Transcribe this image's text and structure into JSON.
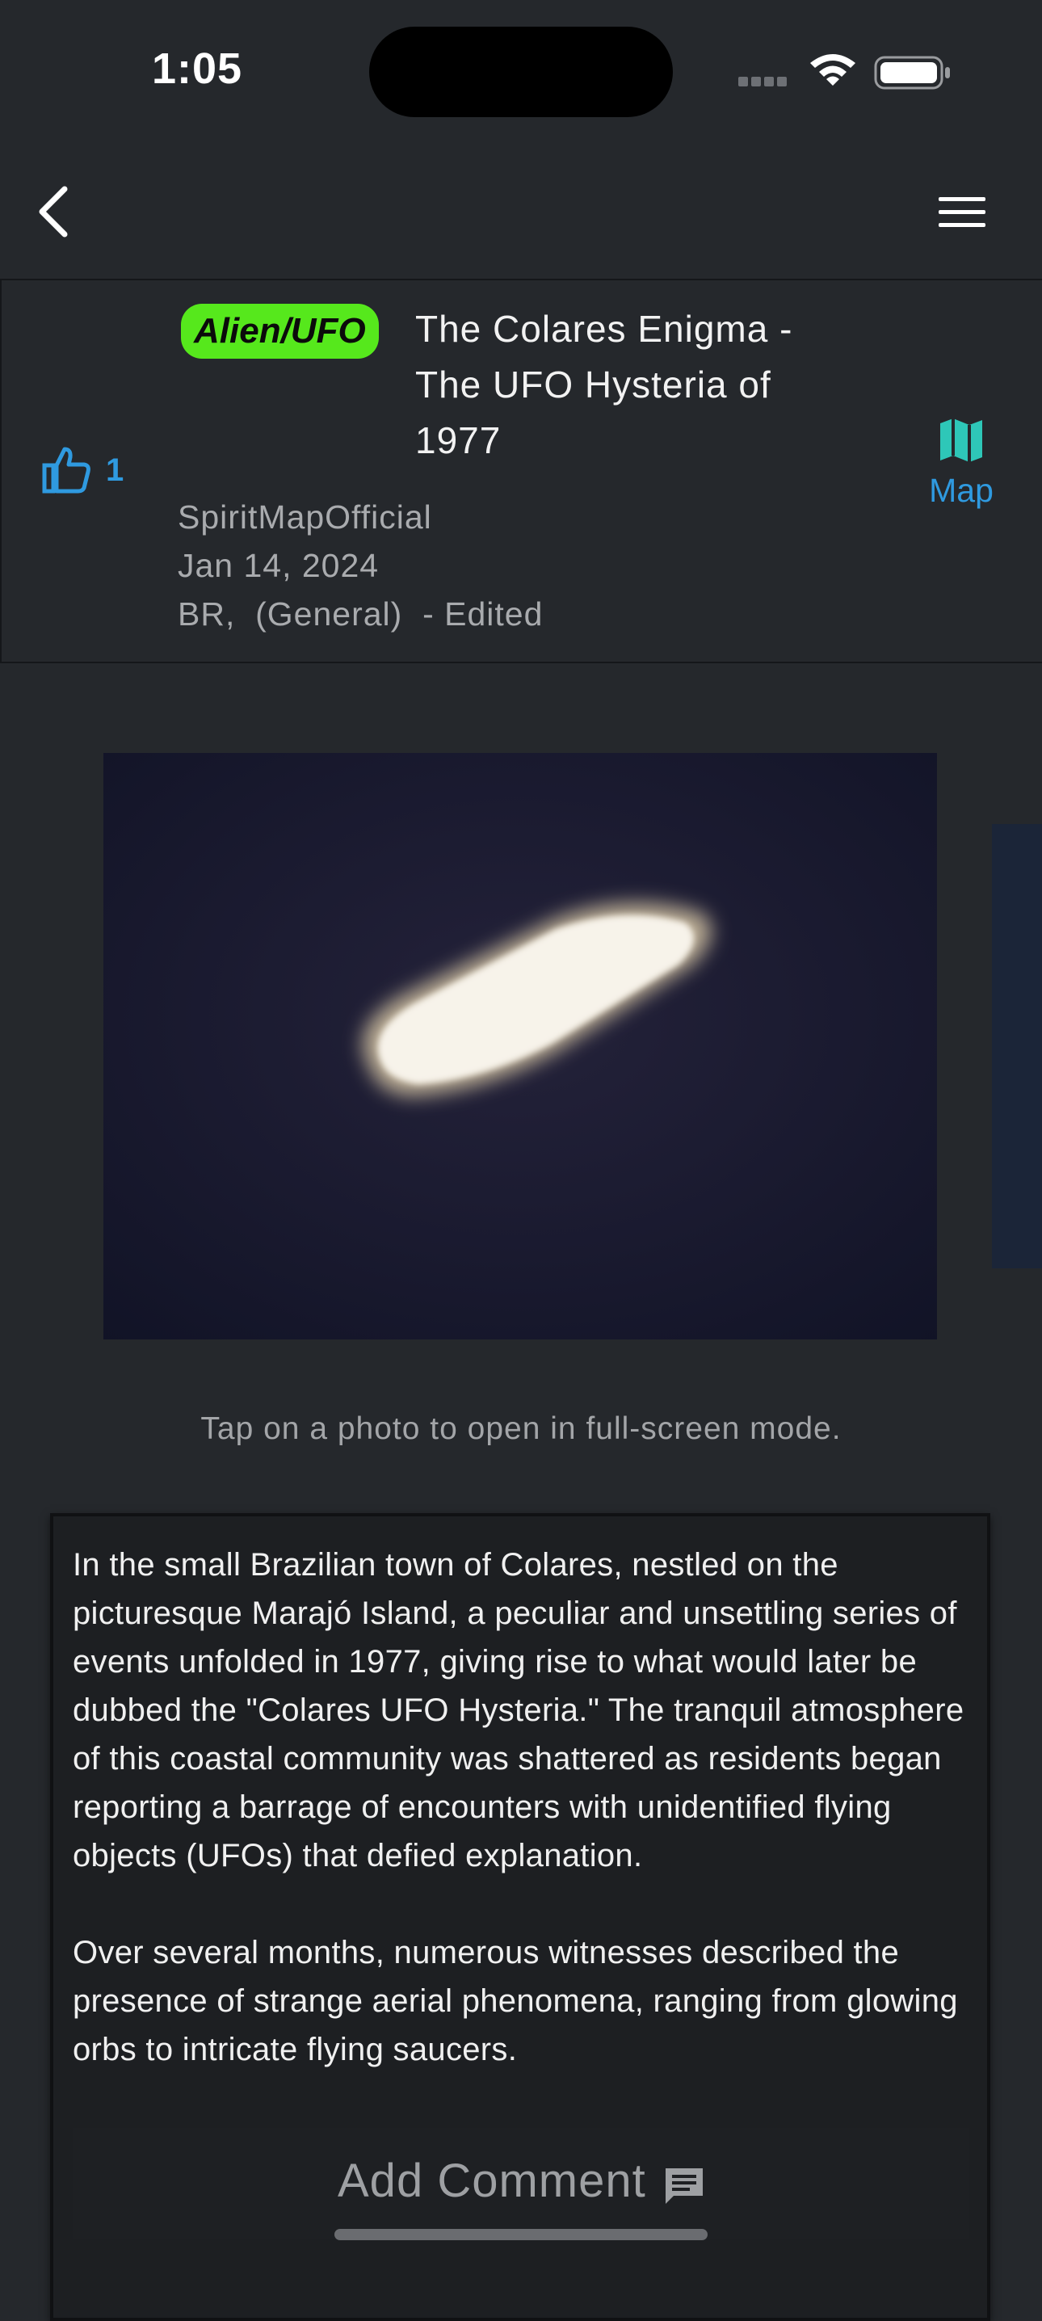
{
  "status_bar": {
    "time": "1:05"
  },
  "post": {
    "category": "Alien/UFO",
    "title": "The Colares Enigma - The UFO Hysteria of 1977",
    "likes": "1",
    "author": "SpiritMapOfficial",
    "date": "Jan 14, 2024",
    "location": "BR,  (General)  - Edited",
    "map_label": "Map",
    "photo_hint": "Tap on a photo to open in full-screen mode.",
    "description": "In the small Brazilian town of Colares, nestled on the picturesque Marajó Island, a peculiar and unsettling series of events unfolded in 1977, giving rise to what would later be dubbed the \"Colares UFO Hysteria.\" The tranquil atmosphere of this coastal community was shattered as residents began reporting a barrage of encounters with unidentified flying objects (UFOs) that defied explanation.\n\nOver several months, numerous witnesses described the presence of strange aerial phenomena, ranging from glowing orbs to intricate flying saucers."
  },
  "footer": {
    "add_comment_label": "Add Comment"
  },
  "colors": {
    "background": "#25282c",
    "accent_blue": "#2f9ae0",
    "map_icon": "#2ec7b8",
    "category_badge": "#56e81c"
  },
  "icons": {
    "back": "chevron-left-icon",
    "menu": "hamburger-menu-icon",
    "like": "thumbs-up-icon",
    "map": "map-icon",
    "comment": "comment-icon",
    "wifi": "wifi-icon",
    "battery": "battery-icon"
  }
}
